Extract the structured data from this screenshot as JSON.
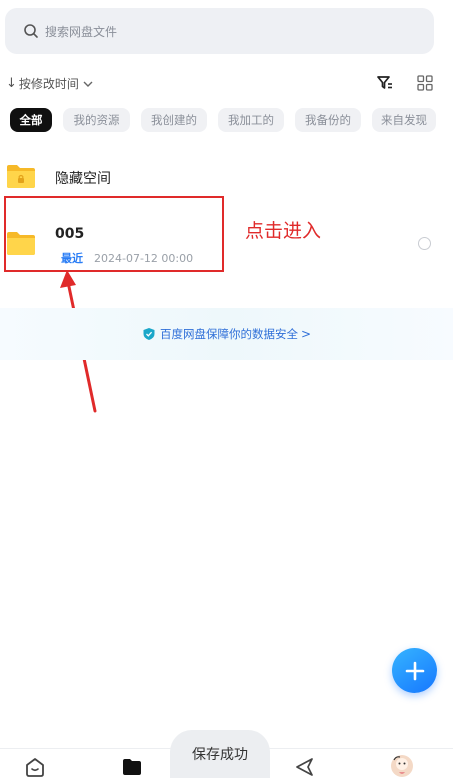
{
  "search": {
    "placeholder": "搜索网盘文件",
    "icon": "search-icon"
  },
  "sort": {
    "label": "按修改时间",
    "icon_arrow": "↓"
  },
  "toolbar": {
    "filter_icon": "filter-icon",
    "view_icon": "grid-view-icon"
  },
  "tabs": [
    {
      "label": "全部",
      "active": true
    },
    {
      "label": "我的资源",
      "active": false
    },
    {
      "label": "我创建的",
      "active": false
    },
    {
      "label": "我加工的",
      "active": false
    },
    {
      "label": "我备份的",
      "active": false
    },
    {
      "label": "来自发现",
      "active": false
    }
  ],
  "files": [
    {
      "name": "隐藏空间",
      "icon": "locked-folder-icon"
    },
    {
      "name": "005",
      "badge": "最近",
      "date": "2024-07-12  00:00",
      "icon": "folder-icon"
    }
  ],
  "annotation": {
    "text": "点击进入"
  },
  "security": {
    "text": "百度网盘保障你的数据安全",
    "chevron": ">"
  },
  "toast": {
    "text": "保存成功"
  },
  "colors": {
    "accent": "#2a7df5",
    "annotation": "#e02a2a",
    "folder": "#f9c02a"
  }
}
